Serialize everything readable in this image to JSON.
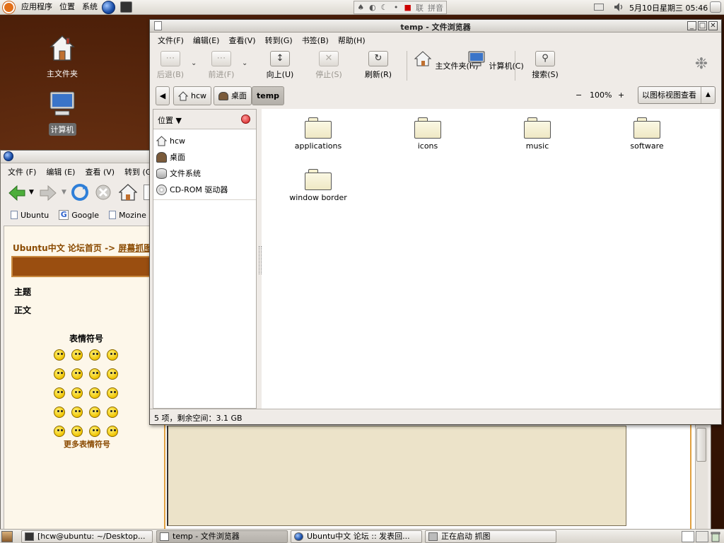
{
  "top_panel": {
    "menus": [
      "应用程序",
      "位置",
      "系统"
    ],
    "tray_text": [
      "联",
      "拼音"
    ],
    "clock": "5月10日星期三 05:46"
  },
  "desktop": {
    "home_label": "主文件夹",
    "computer_label": "计算机"
  },
  "firefox": {
    "menu": [
      "文件 (F)",
      "编辑 (E)",
      "查看 (V)",
      "转到 (G"
    ],
    "bookmarks": [
      "Ubuntu",
      "Google",
      "Mozine"
    ],
    "crumb_home": "Ubuntu中文 论坛首页",
    "crumb_sep": "->",
    "crumb_link": "屏幕抓图",
    "row_subject": "主题",
    "row_body": "正文",
    "smilies_title": "表情符号",
    "more_smilies": "更多表情符号"
  },
  "nautilus": {
    "title": "temp - 文件浏览器",
    "menu": [
      "文件(F)",
      "编辑(E)",
      "查看(V)",
      "转到(G)",
      "书签(B)",
      "帮助(H)"
    ],
    "toolbar": {
      "back": "后退(B)",
      "forward": "前进(F)",
      "up": "向上(U)",
      "stop": "停止(S)",
      "reload": "刷新(R)",
      "home": "主文件夹(H)",
      "computer": "计算机(C)",
      "search": "搜索(S)"
    },
    "path": [
      "hcw",
      "桌面",
      "temp"
    ],
    "zoom": "100%",
    "zoom_minus": "−",
    "zoom_plus": "+",
    "view_mode": "以图标视图查看",
    "sidebar": {
      "header": "位置",
      "items": [
        "hcw",
        "桌面",
        "文件系统",
        "CD-ROM 驱动器"
      ]
    },
    "files": [
      "applications",
      "icons",
      "music",
      "software",
      "window border"
    ],
    "status": "5 项，剩余空间：3.1 GB"
  },
  "taskbar": {
    "tasks": [
      "[hcw@ubuntu: ~/Desktop...",
      "temp - 文件浏览器",
      "Ubuntu中文 论坛 :: 发表回...",
      "正在启动 抓图"
    ]
  },
  "colors": {
    "desktop_bg": "#4a1e08",
    "forum_accent": "#8a4a00",
    "forum_bar": "#9a4e10",
    "ubuntu_orange": "#e2701a"
  },
  "icons": [
    "ubuntu-logo-icon",
    "globe-icon",
    "terminal-icon",
    "volume-icon",
    "home-icon",
    "computer-icon",
    "folder-icon",
    "search-icon",
    "foot-icon",
    "trash-icon"
  ]
}
